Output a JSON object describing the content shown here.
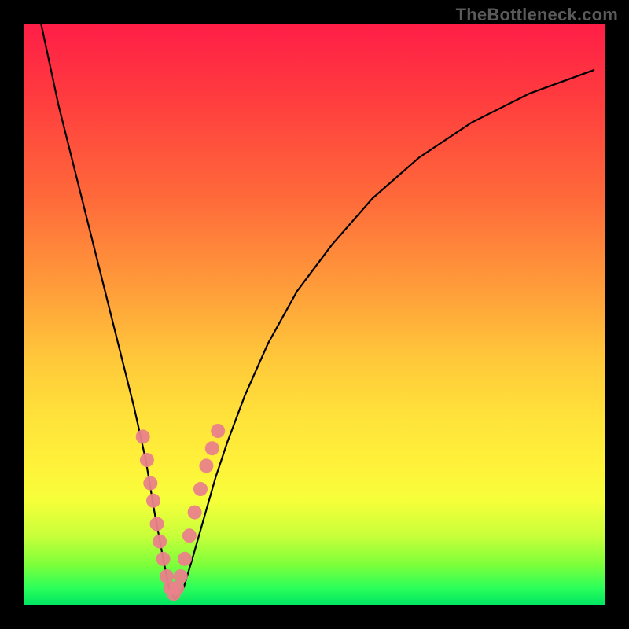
{
  "watermark": "TheBottleneck.com",
  "chart_data": {
    "type": "line",
    "title": "",
    "xlabel": "",
    "ylabel": "",
    "xlim": [
      0,
      100
    ],
    "ylim": [
      0,
      100
    ],
    "grid": false,
    "legend": false,
    "series": [
      {
        "name": "bottleneck-curve",
        "x": [
          3,
          6,
          10,
          14,
          17,
          19,
          21,
          22.5,
          24,
          25,
          26,
          27.5,
          29,
          31,
          33,
          35,
          38,
          42,
          47,
          53,
          60,
          68,
          77,
          87,
          98
        ],
        "y": [
          100,
          86,
          70,
          54,
          42,
          34,
          25,
          16,
          8,
          3,
          1,
          3,
          8,
          15,
          22,
          28,
          36,
          45,
          54,
          62,
          70,
          77,
          83,
          88,
          92
        ],
        "color": "#000000"
      }
    ],
    "markers": [
      {
        "name": "highlighted-points",
        "color": "#e9828a",
        "points_xy": [
          [
            20.5,
            29
          ],
          [
            21.2,
            25
          ],
          [
            21.8,
            21
          ],
          [
            22.3,
            18
          ],
          [
            22.9,
            14
          ],
          [
            23.4,
            11
          ],
          [
            24.0,
            8
          ],
          [
            24.6,
            5
          ],
          [
            25.2,
            3
          ],
          [
            25.8,
            2
          ],
          [
            26.4,
            3
          ],
          [
            27.0,
            5
          ],
          [
            27.7,
            8
          ],
          [
            28.5,
            12
          ],
          [
            29.4,
            16
          ],
          [
            30.4,
            20
          ],
          [
            31.4,
            24
          ],
          [
            32.4,
            27
          ],
          [
            33.4,
            30
          ]
        ]
      }
    ],
    "gradient_background": {
      "top": "#ff1e47",
      "upper_mid": "#ff9b3a",
      "mid": "#ffe33a",
      "lower_mid": "#c8ff3a",
      "bottom": "#00e562"
    }
  }
}
